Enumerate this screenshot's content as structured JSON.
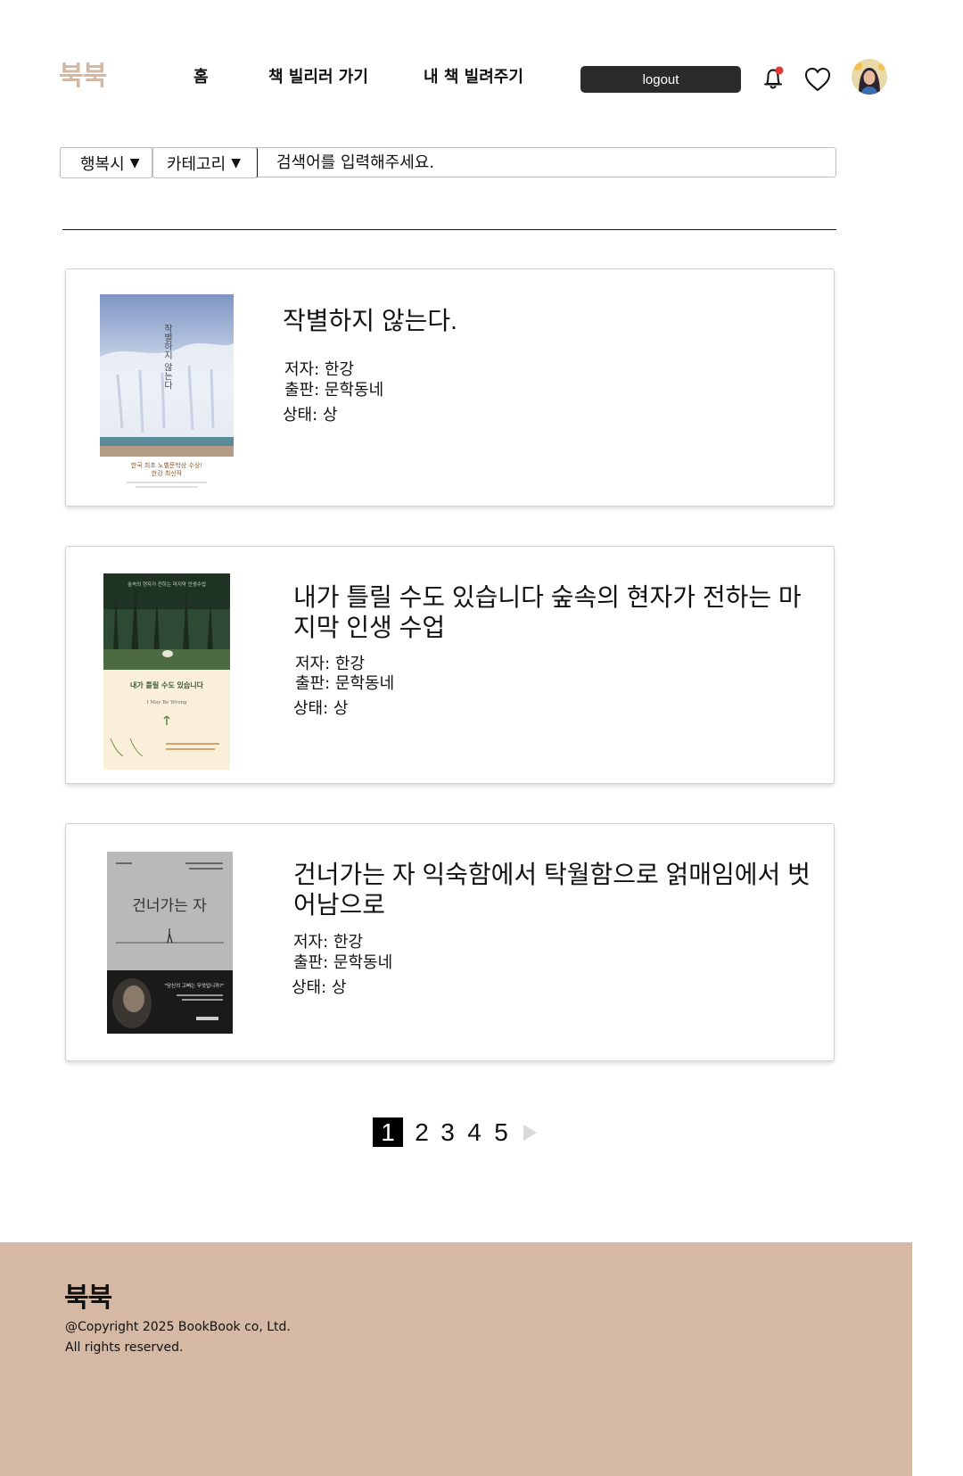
{
  "header": {
    "logo": "북북",
    "nav": [
      {
        "label": "홈"
      },
      {
        "label": "책 빌리러 가기"
      },
      {
        "label": "내 책 빌려주기"
      }
    ],
    "logout_label": "logout",
    "notification_dot_color": "#e53935",
    "icons": [
      "bell-icon",
      "heart-icon",
      "avatar"
    ]
  },
  "search": {
    "region_label": "행복시",
    "region_caret": "▼",
    "category_label": "카테고리",
    "category_caret": "▼",
    "placeholder": "검색어를 입력해주세요."
  },
  "books": [
    {
      "title": "작별하지 않는다.",
      "author": "저자: 한강",
      "publisher": "출판: 문학동네",
      "condition": "상태: 상",
      "cover": {
        "name": "cover-book-1",
        "title_text": "작별하지 않는다",
        "band_line1": "한국 최초 노벨문학상 수상!",
        "band_line2": "한강 최신작"
      }
    },
    {
      "title": "내가 틀릴 수도 있습니다 숲속의 현자가 전하는 마지막 인생 수업",
      "author": "저자: 한강",
      "publisher": "출판: 문학동네",
      "condition": "상태: 상",
      "cover": {
        "name": "cover-book-2",
        "top_text": "숲속의 현자가 전하는 마지막 인생수업",
        "title_text": "내가 틀릴 수도 있습니다",
        "subtitle": "I May Be Wrong"
      }
    },
    {
      "title": "건너가는 자 익숙함에서 탁월함으로 얽매임에서 벗어남으로",
      "author": "저자: 한강",
      "publisher": "출판: 문학동네",
      "condition": "상태: 상",
      "cover": {
        "name": "cover-book-3",
        "title_text": "건너가는 자",
        "quote": "\"당신의 고삐는 무엇입니까?\""
      }
    }
  ],
  "pagination": {
    "pages": [
      "1",
      "2",
      "3",
      "4",
      "5"
    ],
    "current": "1",
    "next_icon": "next-arrow-icon"
  },
  "footer": {
    "logo": "북북",
    "copyright": "@Copyright 2025 BookBook co, Ltd.",
    "rights": "All rights reserved."
  }
}
